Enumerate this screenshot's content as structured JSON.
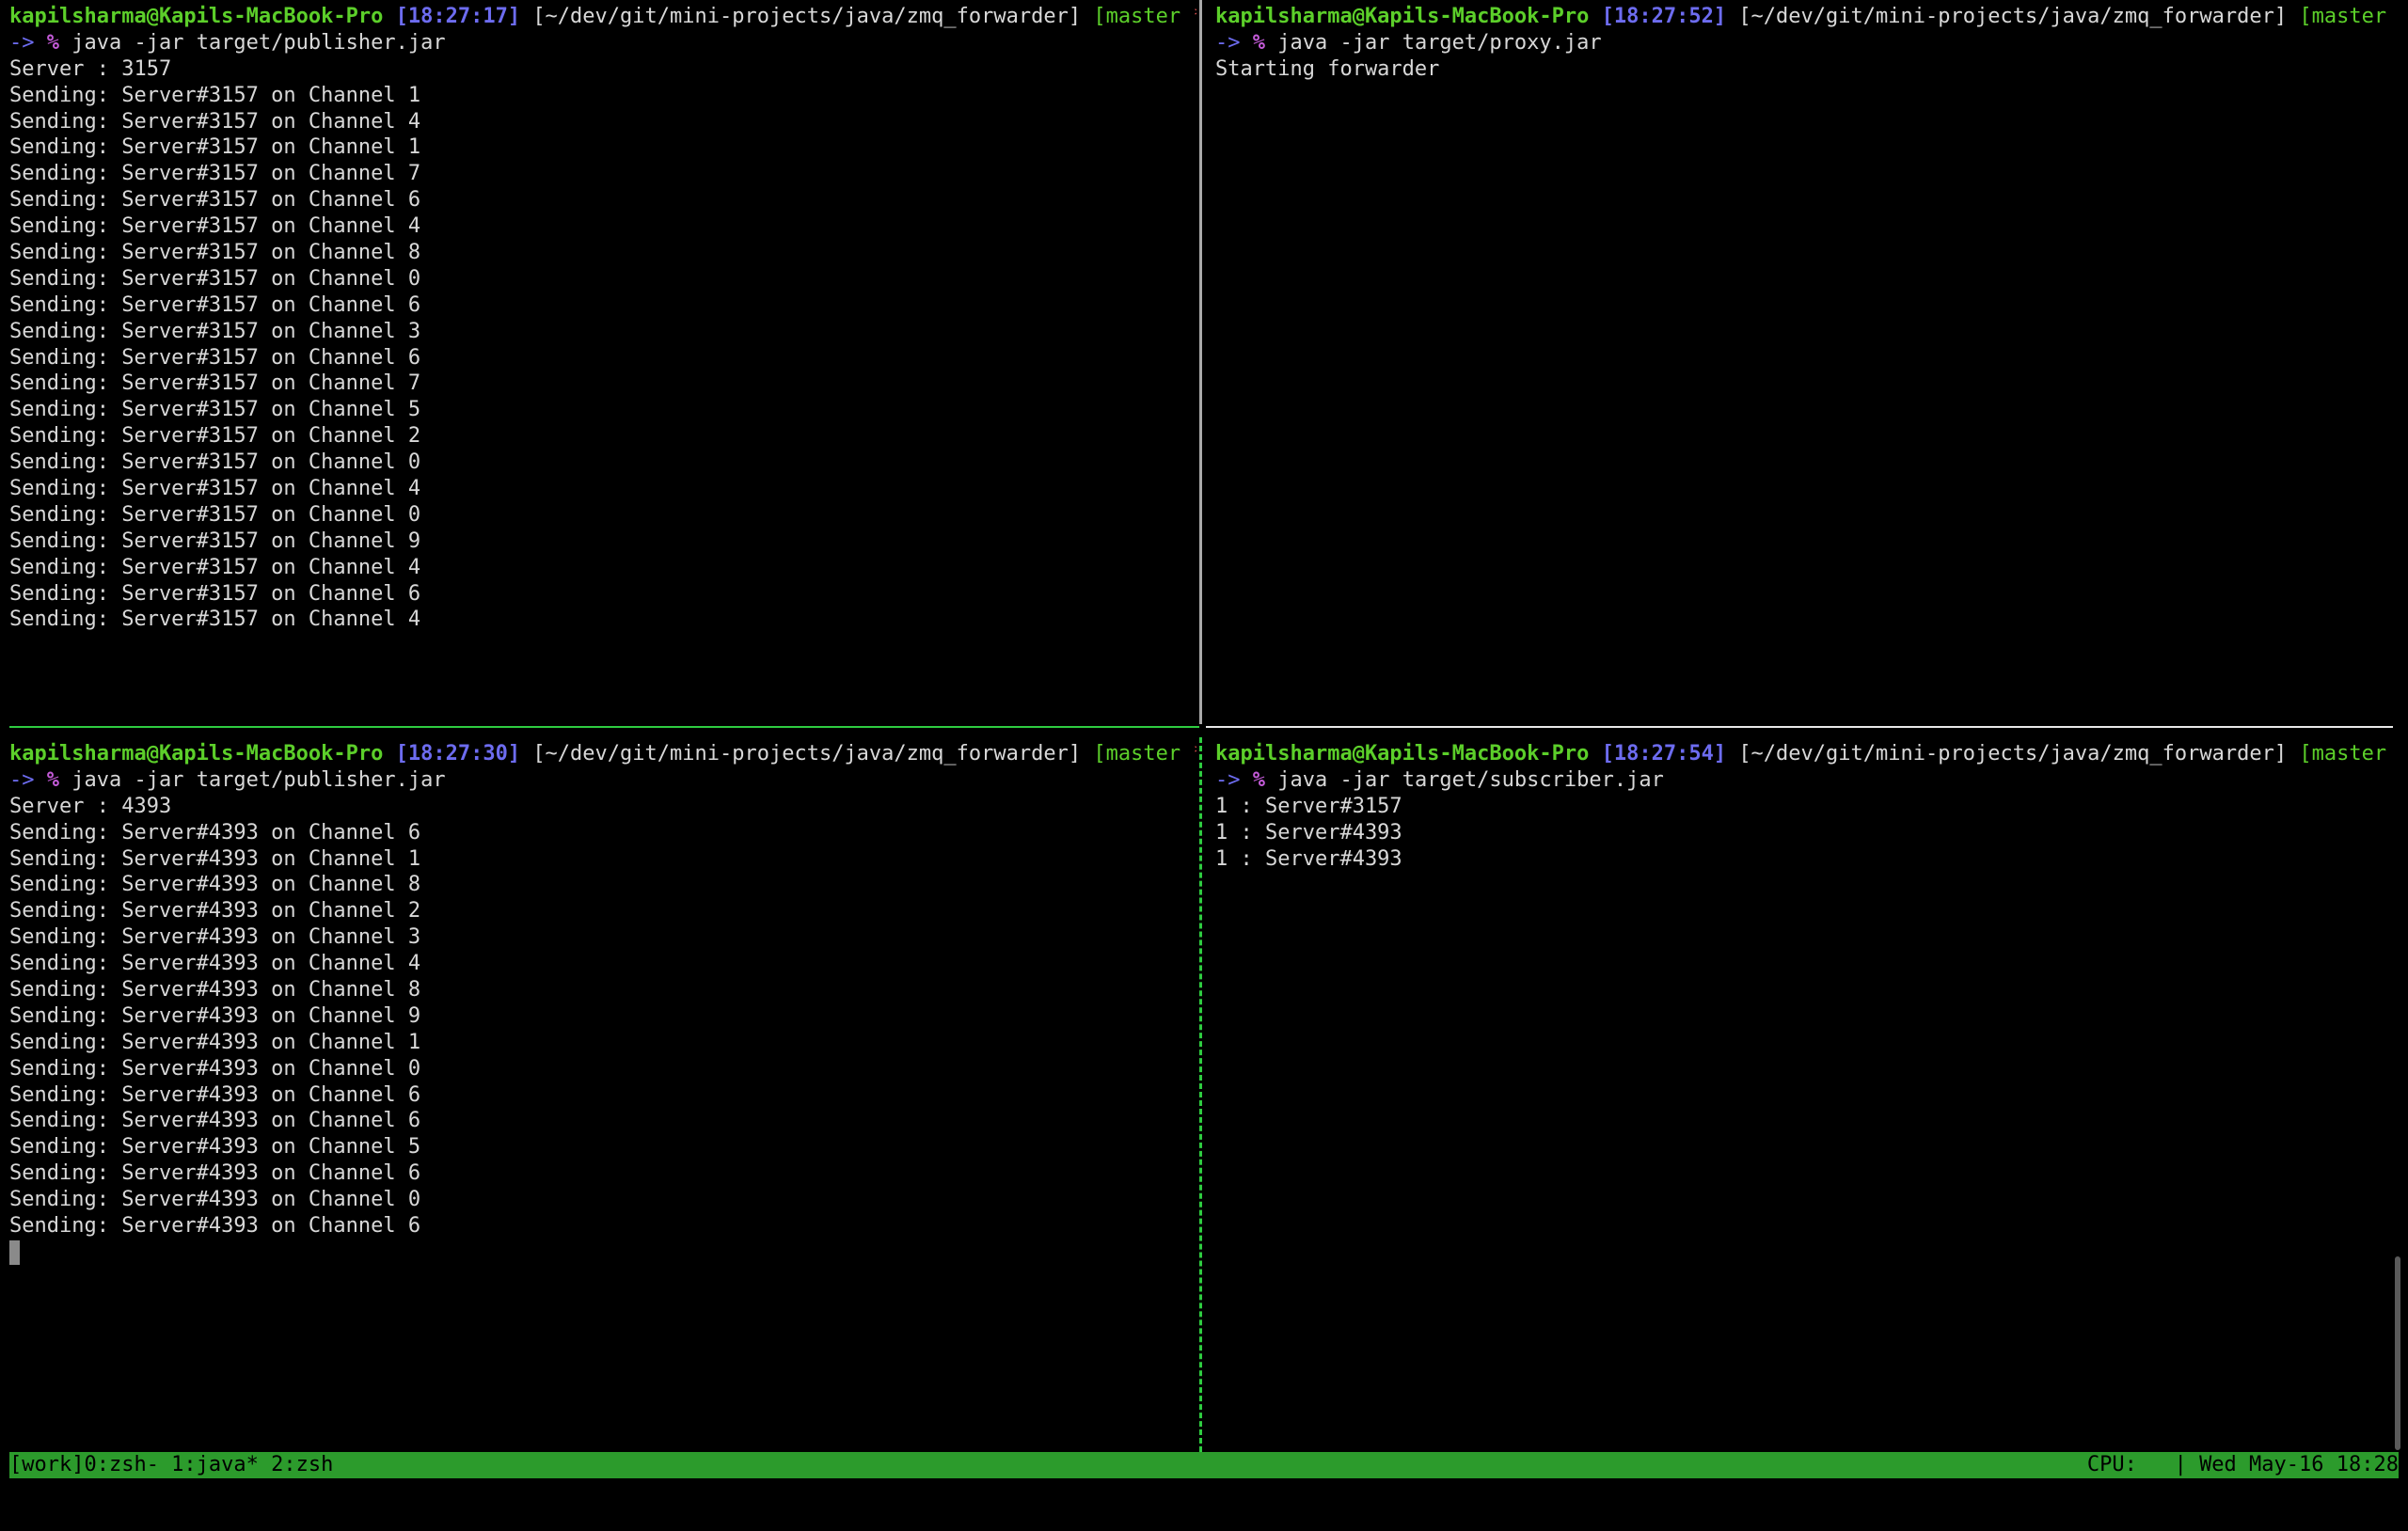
{
  "panes": {
    "top_left": {
      "prompt": {
        "user": "kapilsharma@Kapils-MacBook-Pro",
        "time": "[18:27:17]",
        "path": "[~/dev/git/mini-projects/java/zmq_forwarder]",
        "branch": "[master",
        "star": "*",
        "branch_close": "]"
      },
      "command": {
        "arrow": "->",
        "pct": "%",
        "text": "java -jar target/publisher.jar"
      },
      "output": [
        "Server : 3157",
        "Sending: Server#3157 on Channel 1",
        "Sending: Server#3157 on Channel 4",
        "Sending: Server#3157 on Channel 1",
        "Sending: Server#3157 on Channel 7",
        "Sending: Server#3157 on Channel 6",
        "Sending: Server#3157 on Channel 4",
        "Sending: Server#3157 on Channel 8",
        "Sending: Server#3157 on Channel 0",
        "Sending: Server#3157 on Channel 6",
        "Sending: Server#3157 on Channel 3",
        "Sending: Server#3157 on Channel 6",
        "Sending: Server#3157 on Channel 7",
        "Sending: Server#3157 on Channel 5",
        "Sending: Server#3157 on Channel 2",
        "Sending: Server#3157 on Channel 0",
        "Sending: Server#3157 on Channel 4",
        "Sending: Server#3157 on Channel 0",
        "Sending: Server#3157 on Channel 9",
        "Sending: Server#3157 on Channel 4",
        "Sending: Server#3157 on Channel 6",
        "Sending: Server#3157 on Channel 4"
      ]
    },
    "top_right": {
      "prompt": {
        "user": "kapilsharma@Kapils-MacBook-Pro",
        "time": "[18:27:52]",
        "path": "[~/dev/git/mini-projects/java/zmq_forwarder]",
        "branch": "[master",
        "star": "*",
        "branch_close": "]"
      },
      "command": {
        "arrow": "->",
        "pct": "%",
        "text": "java -jar target/proxy.jar"
      },
      "output": [
        "Starting forwarder"
      ]
    },
    "bottom_left": {
      "prompt": {
        "user": "kapilsharma@Kapils-MacBook-Pro",
        "time": "[18:27:30]",
        "path": "[~/dev/git/mini-projects/java/zmq_forwarder]",
        "branch": "[master",
        "star": "*",
        "branch_close": "]"
      },
      "command": {
        "arrow": "->",
        "pct": "%",
        "text": "java -jar target/publisher.jar"
      },
      "output": [
        "Server : 4393",
        "Sending: Server#4393 on Channel 6",
        "Sending: Server#4393 on Channel 1",
        "Sending: Server#4393 on Channel 8",
        "Sending: Server#4393 on Channel 2",
        "Sending: Server#4393 on Channel 3",
        "Sending: Server#4393 on Channel 4",
        "Sending: Server#4393 on Channel 8",
        "Sending: Server#4393 on Channel 9",
        "Sending: Server#4393 on Channel 1",
        "Sending: Server#4393 on Channel 0",
        "Sending: Server#4393 on Channel 6",
        "Sending: Server#4393 on Channel 6",
        "Sending: Server#4393 on Channel 5",
        "Sending: Server#4393 on Channel 6",
        "Sending: Server#4393 on Channel 0",
        "Sending: Server#4393 on Channel 6"
      ]
    },
    "bottom_right": {
      "prompt": {
        "user": "kapilsharma@Kapils-MacBook-Pro",
        "time": "[18:27:54]",
        "path": "[~/dev/git/mini-projects/java/zmq_forwarder]",
        "branch": "[master",
        "star": "*",
        "branch_close": "]"
      },
      "command": {
        "arrow": "->",
        "pct": "%",
        "text": "java -jar target/subscriber.jar"
      },
      "output": [
        "1 : Server#3157",
        "1 : Server#4393",
        "1 : Server#4393"
      ]
    }
  },
  "statusbar": {
    "left": "[work]0:zsh- 1:java* 2:zsh",
    "right": "CPU:   | Wed May-16 18:28"
  },
  "colors": {
    "background": "#000000",
    "prompt_green": "#5ccf2a",
    "prompt_blue": "#6d6cf0",
    "status_green": "#2c9b2c"
  }
}
